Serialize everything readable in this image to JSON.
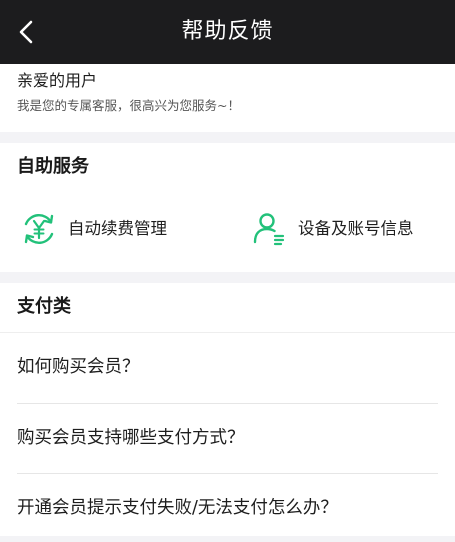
{
  "header": {
    "title": "帮助反馈",
    "back_icon": "chevron-left-icon"
  },
  "greeting": {
    "title": "亲爱的用户",
    "subtitle": "我是您的专属客服，很高兴为您服务~！"
  },
  "self_service": {
    "title": "自助服务",
    "items": [
      {
        "label": "自动续费管理",
        "icon": "yuan-renew-icon"
      },
      {
        "label": "设备及账号信息",
        "icon": "user-account-icon"
      }
    ]
  },
  "payment": {
    "title": "支付类",
    "questions": [
      "如何购买会员？",
      "购买会员支持哪些支付方式？",
      "开通会员提示支付失败/无法支付怎么办？"
    ]
  },
  "colors": {
    "header_bg": "#1c1c1e",
    "accent_green": "#22c17a",
    "page_bg": "#f3f3f6"
  }
}
